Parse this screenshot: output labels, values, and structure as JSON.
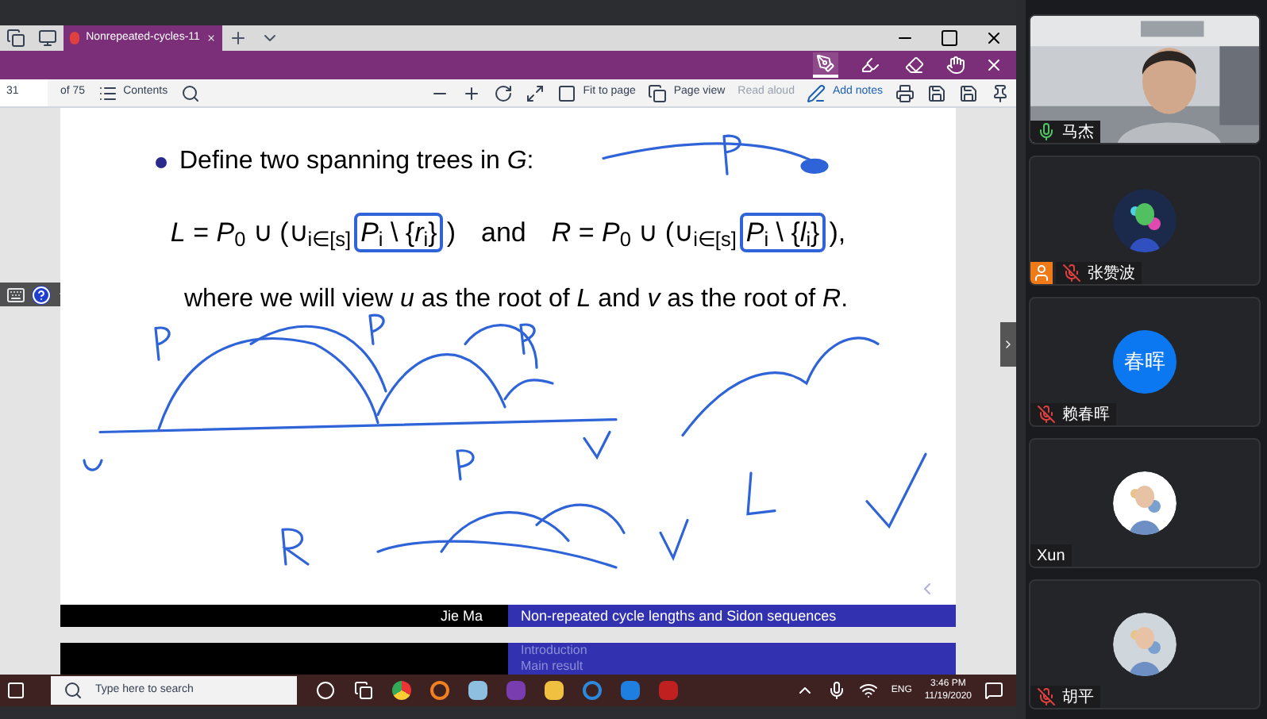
{
  "browser": {
    "tab_title": "Nonrepeated-cycles-11"
  },
  "ink_tools": [
    {
      "kind": "pen",
      "selected": true
    },
    {
      "kind": "highlighter",
      "selected": false
    },
    {
      "kind": "eraser",
      "selected": false
    }
  ],
  "pdf_toolbar": {
    "page": "31",
    "page_count": "of 75",
    "contents": "Contents",
    "fit": "Fit to page",
    "page_view": "Page view",
    "read_aloud": {
      "label": "Read aloud",
      "disabled": true
    },
    "add_notes": "Add notes"
  },
  "slide": {
    "bullet": "Define two spanning trees in *G*:",
    "formulas": [
      {
        "before": "*L* = *P*$_{0}$ ∪ (∪$_{i∈[s]}$",
        "boxed": "*P*$_{i}$ \\ {*r*$_{i}$}",
        "after": ")"
      },
      {
        "before": "*R* = *P*$_{0}$ ∪ (∪$_{i∈[s]}$",
        "boxed": "*P*$_{i}$ \\ {*l*$_{i}$}",
        "after": "),"
      }
    ],
    "connector": "and",
    "sentence": "where we will view *u* as the root of *L* and *v* as the root of *R*.",
    "footer_author": "Jie Ma",
    "footer_title": "Non-repeated cycle lengths and Sidon sequences"
  },
  "next_slide": {
    "sections": [
      "Introduction",
      "Main result"
    ]
  },
  "participants": [
    {
      "name": "马杰",
      "kind": "video",
      "muted": false,
      "host": false
    },
    {
      "name": "张赞波",
      "kind": "picture",
      "muted": true,
      "host": true
    },
    {
      "name": "赖春晖",
      "kind": "initials",
      "initials": "春晖",
      "muted": true,
      "host": false
    },
    {
      "name": "Xun",
      "kind": "picture",
      "host": false
    },
    {
      "name": "胡平",
      "kind": "picture",
      "muted": true,
      "host": false
    }
  ],
  "taskbar": {
    "search_placeholder": "Type here to search",
    "language": "ENG",
    "time": "3:46 PM",
    "date": "11/19/2020"
  }
}
